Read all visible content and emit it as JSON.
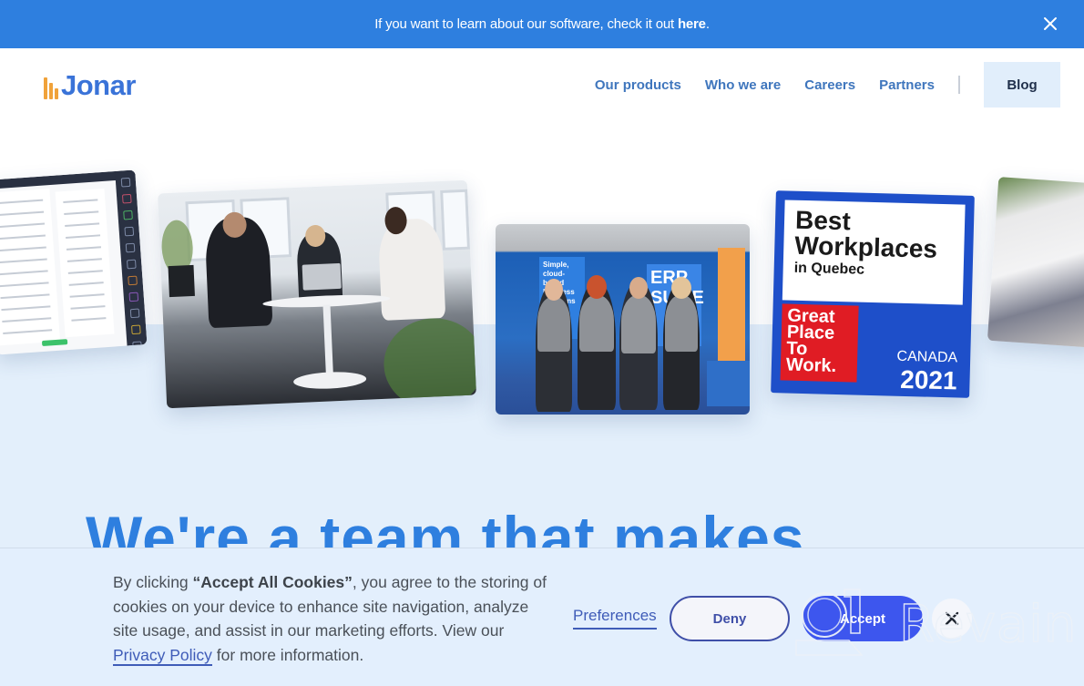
{
  "announcement": {
    "text": "If you want to learn about our software, check it out ",
    "link": "here",
    "suffix": ".",
    "close_icon": "close-icon"
  },
  "header": {
    "logo": "Jonar",
    "nav": [
      {
        "label": "Our products"
      },
      {
        "label": "Who we are"
      },
      {
        "label": "Careers"
      },
      {
        "label": "Partners"
      }
    ],
    "blog_button": "Blog"
  },
  "gallery": {
    "booth_banners": [
      "Simple, cloud-based business solutions",
      "ERP SUITE"
    ],
    "award": {
      "title_line1": "Best",
      "title_line2": "Workplaces",
      "subtitle": "in Quebec",
      "badge_line1": "Great",
      "badge_line2": "Place",
      "badge_line3": "To",
      "badge_line4": "Work.",
      "country": "CANADA",
      "year": "2021"
    }
  },
  "hero": {
    "title": "We're a team that makes"
  },
  "cookie_banner": {
    "text_prefix": "By clicking ",
    "text_bold": "“Accept All Cookies”",
    "text_middle": ", you agree to the storing of cookies on your device to enhance site navigation, analyze site usage, and assist in our marketing efforts. View our ",
    "privacy_link": "Privacy Policy",
    "text_suffix": " for more information.",
    "preferences": "Preferences",
    "deny": "Deny",
    "accept": "Accept"
  },
  "watermark": {
    "text": "Revain"
  },
  "colors": {
    "announcement_bg": "#2e7fdf",
    "brand_blue": "#3a73d8",
    "brand_orange": "#f0a23a",
    "nav_text": "#3f76bd",
    "accept_bg": "#3d56ee",
    "cookie_bg": "#e3effd"
  }
}
